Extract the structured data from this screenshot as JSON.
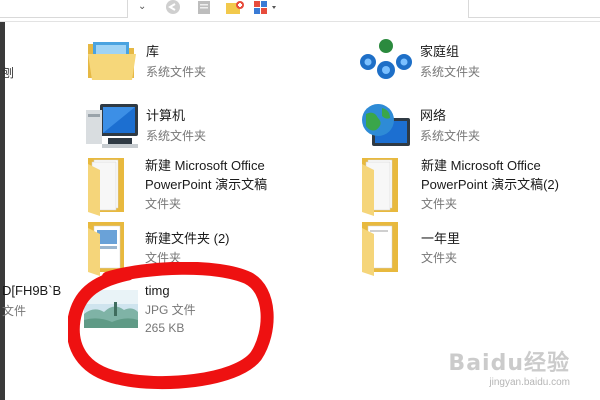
{
  "toolbar": {
    "dropdown_glyph": "⌄"
  },
  "nav": {
    "text_top": "刨",
    "text_file_id": "D[FH9B`B",
    "text_file_type": "文件"
  },
  "items": [
    {
      "name": "库",
      "type": "系统文件夹",
      "icon": "library-icon"
    },
    {
      "name": "家庭组",
      "type": "系统文件夹",
      "icon": "homegroup-icon"
    },
    {
      "name": "计算机",
      "type": "系统文件夹",
      "icon": "computer-icon"
    },
    {
      "name": "网络",
      "type": "系统文件夹",
      "icon": "network-icon"
    },
    {
      "name_line1": "新建 Microsoft Office",
      "name_line2": "PowerPoint 演示文稿",
      "type": "文件夹",
      "icon": "folder-icon"
    },
    {
      "name_line1": "新建 Microsoft Office",
      "name_line2": "PowerPoint 演示文稿(2)",
      "type": "文件夹",
      "icon": "folder-icon"
    },
    {
      "name": "新建文件夹 (2)",
      "type": "文件夹",
      "icon": "folder-icon"
    },
    {
      "name": "一年里",
      "type": "文件夹",
      "icon": "folder-icon"
    },
    {
      "name": "timg",
      "type": "JPG 文件",
      "size": "265 KB",
      "icon": "image-thumbnail"
    }
  ],
  "watermark": {
    "logo": "Baidu经验",
    "url": "jingyan.baidu.com"
  },
  "colors": {
    "annotation": "#ee1111",
    "folder": "#f2c94c",
    "system_blue": "#1e6fc7"
  }
}
